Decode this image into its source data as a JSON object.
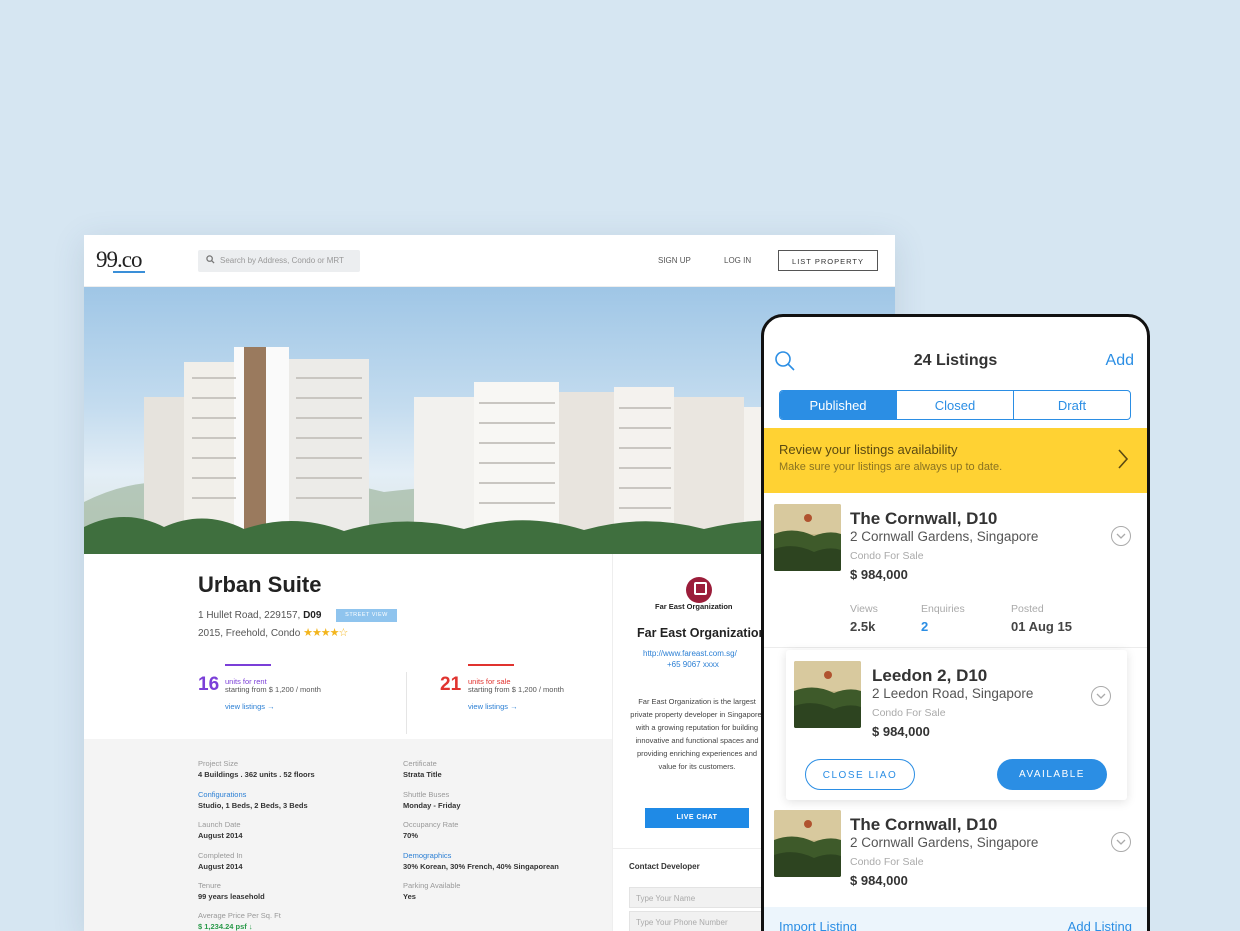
{
  "web": {
    "logo": "99.co",
    "search_placeholder": "Search by Address, Condo or MRT",
    "nav": {
      "sign_up": "SIGN UP",
      "log_in": "LOG IN",
      "list_property": "LIST PROPERTY"
    },
    "property": {
      "title": "Urban Suite",
      "address": "1 Hullet Road, 229157,",
      "district": "D09",
      "street_view": "STREET VIEW",
      "meta": "2015, Freehold, Condo",
      "stars": "★★★★☆",
      "rating": 4
    },
    "rent": {
      "count": "16",
      "type": "units for rent",
      "from": "starting from $ 1,200 / month",
      "link": "view listings →",
      "color": "#7b3fd8"
    },
    "sale": {
      "count": "21",
      "type": "units for sale",
      "from": "starting from $ 1,200 / month",
      "link": "view listings →",
      "color": "#e0332f"
    },
    "facts": [
      {
        "label": "Project Size",
        "value": "4 Buildings . 362 units . 52 floors"
      },
      {
        "label": "Configurations",
        "value": "Studio, 1 Beds, 2 Beds, 3 Beds",
        "link": true
      },
      {
        "label": "Launch Date",
        "value": "August 2014"
      },
      {
        "label": "Completed In",
        "value": "August 2014"
      },
      {
        "label": "Tenure",
        "value": "99 years leasehold"
      },
      {
        "label": "Average Price Per Sq. Ft",
        "value": "$ 1,234.24 psf ↓",
        "green": true
      },
      {
        "label": "Certificate",
        "value": "Strata Title"
      },
      {
        "label": "Shuttle Buses",
        "value": "Monday - Friday"
      },
      {
        "label": "Occupancy Rate",
        "value": "70%"
      },
      {
        "label": "Demographics",
        "value": "30% Korean, 30% French, 40% Singaporean",
        "link": true
      },
      {
        "label": "Parking Available",
        "value": "Yes"
      }
    ],
    "developer": {
      "logo_text": "Far East Organization",
      "name": "Far East Organization",
      "url": "http://www.fareast.com.sg/",
      "phone": "+65 9067 xxxx",
      "description": "Far East Organization is the largest private property developer in Singapore, with a growing reputation for building innovative and functional spaces and providing enriching experiences and value for its customers.",
      "chat": "LIVE CHAT",
      "contact": "Contact Developer",
      "name_placeholder": "Type Your Name",
      "phone_placeholder": "Type Your Phone Number"
    }
  },
  "mobile": {
    "title": "24 Listings",
    "add": "Add",
    "tabs": [
      "Published",
      "Closed",
      "Draft"
    ],
    "active_tab": "Published",
    "banner": {
      "title": "Review your listings availability",
      "subtitle": "Make sure your listings are always up to date."
    },
    "listings": [
      {
        "title": "The Cornwall, D10",
        "address": "2 Cornwall Gardens, Singapore",
        "type": "Condo For Sale",
        "price": "$ 984,000"
      },
      {
        "title": "Leedon 2, D10",
        "address": "2 Leedon Road, Singapore",
        "type": "Condo For Sale",
        "price": "$ 984,000"
      },
      {
        "title": "The Cornwall, D10",
        "address": "2 Cornwall Gardens, Singapore",
        "type": "Condo For Sale",
        "price": "$ 984,000"
      }
    ],
    "stats": [
      {
        "label": "Views",
        "value": "2.5k"
      },
      {
        "label": "Enquiries",
        "value": "2"
      },
      {
        "label": "Posted",
        "value": "01 Aug 15"
      }
    ],
    "close_btn": "CLOSE LIAO",
    "available_btn": "AVAILABLE",
    "footer": {
      "import": "Import Listing",
      "add": "Add Listing"
    }
  },
  "colors": {
    "accent": "#2b8ee4",
    "banner": "#ffd233",
    "rent": "#7b3fd8",
    "sale": "#e0332f"
  }
}
